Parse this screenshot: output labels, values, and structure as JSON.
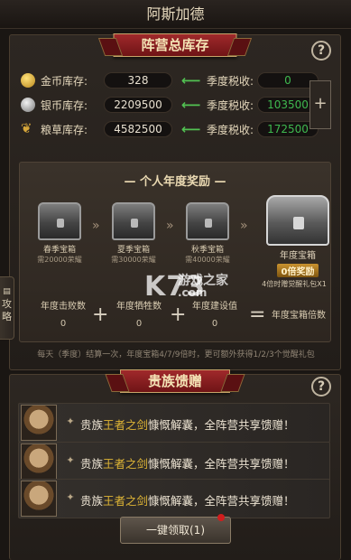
{
  "header": {
    "title": "阿斯加德"
  },
  "stock_panel": {
    "ribbon": "阵营总库存",
    "help_icon": "question-icon",
    "resources": [
      {
        "label": "金币库存:",
        "value": "328",
        "tax_label": "季度税收:",
        "tax": "0",
        "color": "#d4a93a"
      },
      {
        "label": "银币库存:",
        "value": "2209500",
        "tax_label": "季度税收:",
        "tax": "103500",
        "color": "#b5b5b5"
      },
      {
        "label": "粮草库存:",
        "value": "4582500",
        "tax_label": "季度税收:",
        "tax": "172500",
        "color": "#d1a33c"
      }
    ],
    "plus_label": "+"
  },
  "annual_reward": {
    "title": "个人年度奖励",
    "chests": [
      {
        "name": "春季宝箱",
        "req": "需20000荣耀"
      },
      {
        "name": "夏季宝箱",
        "req": "需30000荣耀"
      },
      {
        "name": "秋季宝箱",
        "req": "需40000荣耀"
      }
    ],
    "final_chest": {
      "name": "年度宝箱",
      "badge": "0倍奖励",
      "desc": "4倍时赠觉醒礼包X1"
    },
    "formula": [
      {
        "label": "年度击败数",
        "value": "0"
      },
      {
        "label": "年度牺牲数",
        "value": "0"
      },
      {
        "label": "年度建设值",
        "value": "0"
      },
      {
        "label": "年度宝箱倍数",
        "value": ""
      }
    ],
    "info": "每天（季度）结算一次，年度宝箱4/7/9倍时，更可额外获得1/2/3个觉醒礼包"
  },
  "side_tab": {
    "label": "攻略"
  },
  "gift_panel": {
    "ribbon": "贵族馈赠",
    "help_icon": "question-icon",
    "rows": [
      {
        "pre": "贵族",
        "name": "王者之剑",
        "post": "慷慨解囊，全阵营共享馈赠！"
      },
      {
        "pre": "贵族",
        "name": "王者之剑",
        "post": "慷慨解囊，全阵营共享馈赠！"
      },
      {
        "pre": "贵族",
        "name": "王者之剑",
        "post": "慷慨解囊，全阵营共享馈赠！"
      }
    ],
    "claim_button": "一键领取(1)"
  },
  "watermark": {
    "big": "K73",
    "small": "游戏之家",
    "url": ".com"
  }
}
